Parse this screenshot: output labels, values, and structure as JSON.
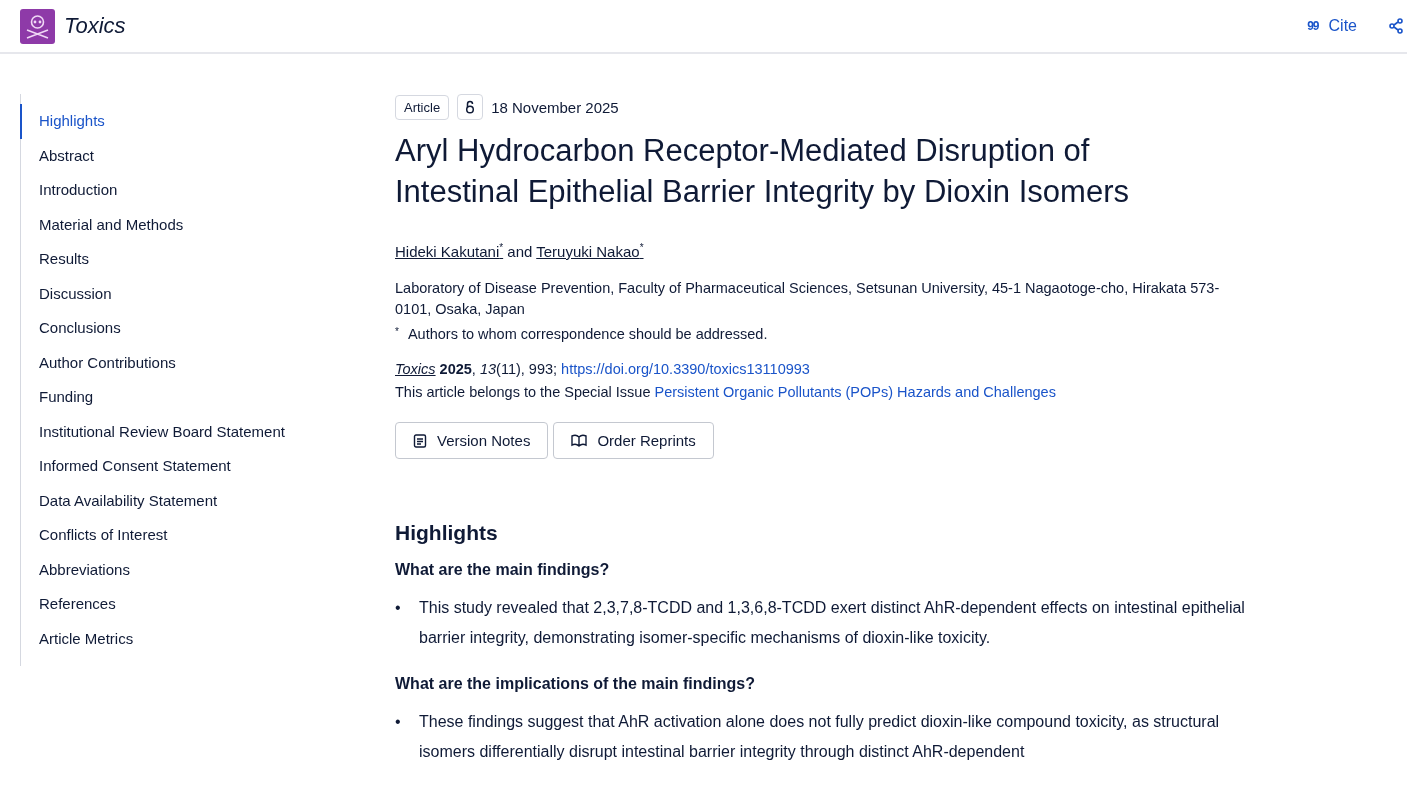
{
  "header": {
    "journal": "Toxics",
    "cite_icon": "99",
    "cite": "Cite"
  },
  "sidebar": {
    "items": [
      {
        "label": "Highlights",
        "selected": true
      },
      {
        "label": "Abstract",
        "selected": false
      },
      {
        "label": "Introduction",
        "selected": false
      },
      {
        "label": "Material and Methods",
        "selected": false
      },
      {
        "label": "Results",
        "selected": false
      },
      {
        "label": "Discussion",
        "selected": false
      },
      {
        "label": "Conclusions",
        "selected": false
      },
      {
        "label": "Author Contributions",
        "selected": false
      },
      {
        "label": "Funding",
        "selected": false
      },
      {
        "label": "Institutional Review Board Statement",
        "selected": false
      },
      {
        "label": "Informed Consent Statement",
        "selected": false
      },
      {
        "label": "Data Availability Statement",
        "selected": false
      },
      {
        "label": "Conflicts of Interest",
        "selected": false
      },
      {
        "label": "Abbreviations",
        "selected": false
      },
      {
        "label": "References",
        "selected": false
      },
      {
        "label": "Article Metrics",
        "selected": false
      }
    ]
  },
  "article": {
    "type": "Article",
    "open_access": true,
    "date": "18 November 2025",
    "title": "Aryl Hydrocarbon Receptor-Mediated Disruption of Intestinal Epithelial Barrier Integrity by Dioxin Isomers",
    "authors": [
      {
        "name": "Hideki Kakutani",
        "mark": "*"
      },
      {
        "name": "Teruyuki Nakao",
        "mark": "*"
      }
    ],
    "authors_joiner": "and",
    "affiliation": "Laboratory of Disease Prevention, Faculty of Pharmaceutical Sciences, Setsunan University, 45-1 Nagaotoge-cho, Hirakata 573-0101, Osaka, Japan",
    "footnote": {
      "mark": "*",
      "text": "Authors to whom correspondence should be addressed."
    },
    "citation": {
      "journal": "Toxics",
      "details": " **2025**, *13*(11), 993; ",
      "doi": "https://doi.org/10.3390/toxics13110993"
    },
    "special_issue": {
      "prefix": "This article belongs to the Special Issue ",
      "link": "Persistent Organic Pollutants (POPs) Hazards and Challenges"
    },
    "buttons": [
      {
        "kind": "notes",
        "label": "Version Notes"
      },
      {
        "kind": "book",
        "label": "Order Reprints"
      }
    ]
  },
  "highlights": {
    "heading": "Highlights",
    "sections": [
      {
        "question": "What are the main findings?",
        "bullets": [
          {
            "marker": "•",
            "text": "This study revealed that 2,3,7,8-TCDD and 1,3,6,8-TCDD exert distinct AhR-dependent effects on intestinal epithelial barrier integrity, demonstrating isomer-specific mechanisms of dioxin-like toxicity."
          }
        ]
      },
      {
        "question": "What are the implications of the main findings?",
        "bullets": [
          {
            "marker": "•",
            "text": "These findings suggest that AhR activation alone does not fully predict dioxin-like compound toxicity, as structural isomers differentially disrupt intestinal barrier integrity through distinct AhR-dependent"
          }
        ]
      }
    ]
  }
}
